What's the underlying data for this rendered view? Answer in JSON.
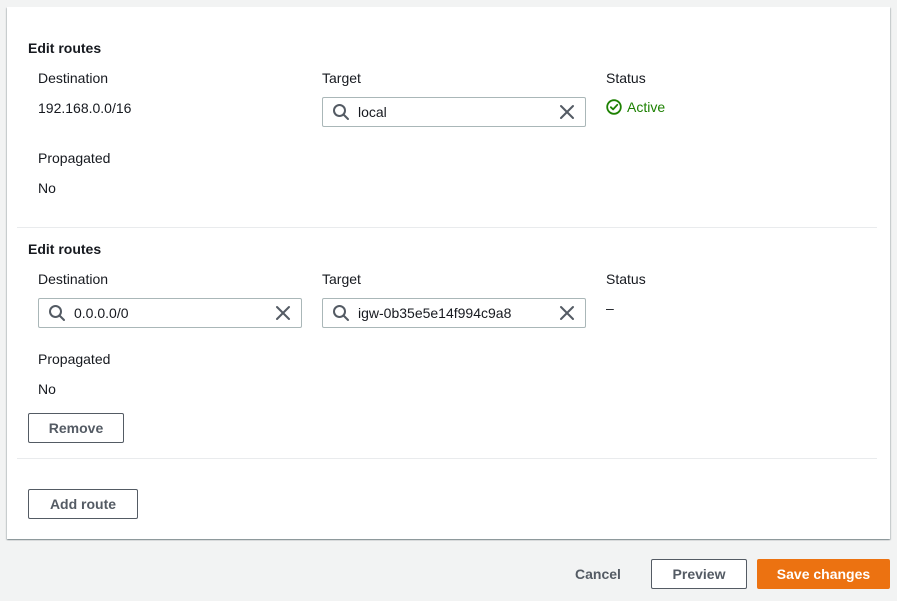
{
  "routes": [
    {
      "title": "Edit routes",
      "destination_label": "Destination",
      "target_label": "Target",
      "status_label": "Status",
      "destination_value": "192.168.0.0/16",
      "target_value": "local",
      "status_value": "Active",
      "propagated_label": "Propagated",
      "propagated_value": "No"
    },
    {
      "title": "Edit routes",
      "destination_label": "Destination",
      "target_label": "Target",
      "status_label": "Status",
      "destination_value": "0.0.0.0/0",
      "target_value": "igw-0b35e5e14f994c9a8",
      "status_value": "–",
      "propagated_label": "Propagated",
      "propagated_value": "No",
      "remove_label": "Remove"
    }
  ],
  "add_route_label": "Add route",
  "footer": {
    "cancel_label": "Cancel",
    "preview_label": "Preview",
    "save_label": "Save changes"
  },
  "colors": {
    "primary": "#ec7211",
    "success": "#1d8102",
    "text": "#16191f",
    "button_text": "#545b64"
  },
  "icons": {
    "search": "search-icon",
    "clear": "close-icon",
    "status": "check-circle-icon"
  }
}
